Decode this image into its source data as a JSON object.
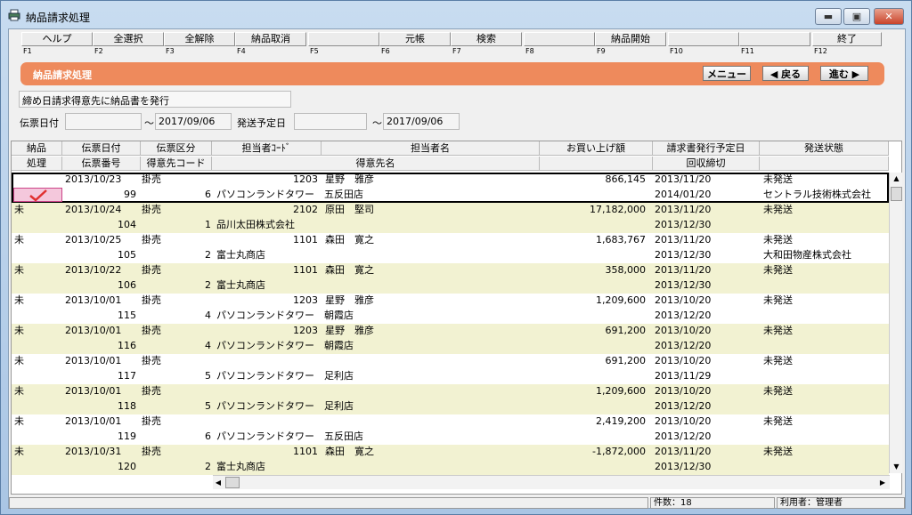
{
  "window": {
    "title": "納品請求処理"
  },
  "fkeys": [
    {
      "label": "ヘルプ",
      "key": "F1"
    },
    {
      "label": "全選択",
      "key": "F2"
    },
    {
      "label": "全解除",
      "key": "F3"
    },
    {
      "label": "納品取消",
      "key": "F4"
    },
    {
      "label": "",
      "key": "F5"
    },
    {
      "label": "元帳",
      "key": "F6"
    },
    {
      "label": "検索",
      "key": "F7"
    },
    {
      "label": "",
      "key": "F8"
    },
    {
      "label": "納品開始",
      "key": "F9"
    },
    {
      "label": "",
      "key": "F10"
    },
    {
      "label": "",
      "key": "F11"
    },
    {
      "label": "終了",
      "key": "F12"
    }
  ],
  "banner": {
    "title": "納品請求処理",
    "menu": "メニュー",
    "back": "◀ 戻る",
    "next": "進む ▶"
  },
  "description": "締め日請求得意先に納品書を発行",
  "filters": {
    "slip_date_label": "伝票日付",
    "slip_from": "",
    "tilde1": "～",
    "slip_to": "2017/09/06",
    "ship_date_label": "発送予定日",
    "ship_from": "",
    "tilde2": "～",
    "ship_to": "2017/09/06"
  },
  "headers": {
    "row1": [
      "納品",
      "伝票日付",
      "伝票区分",
      "担当者ｺｰﾄﾞ",
      "担当者名",
      "お買い上げ額",
      "請求書発行予定日",
      "発送状態"
    ],
    "row2": [
      "処理",
      "伝票番号",
      "得意先コード",
      "得意先名",
      "回収締切"
    ]
  },
  "rows": [
    {
      "status": "",
      "date": "2013/10/23",
      "kind": "掛売",
      "staff_code": "1203",
      "staff": "星野　雅彦",
      "amount": "866,145",
      "bill_date": "2013/11/20",
      "ship": "未発送",
      "no": "99",
      "cust_code": "6",
      "cust": "パソコンランドタワー　五反田店",
      "due": "2014/01/20",
      "ship2": "セントラル技術株式会社",
      "checked": true
    },
    {
      "status": "未",
      "date": "2013/10/24",
      "kind": "掛売",
      "staff_code": "2102",
      "staff": "原田　堅司",
      "amount": "17,182,000",
      "bill_date": "2013/11/20",
      "ship": "未発送",
      "no": "104",
      "cust_code": "1",
      "cust": "品川太田株式会社",
      "due": "2013/12/30",
      "ship2": ""
    },
    {
      "status": "未",
      "date": "2013/10/25",
      "kind": "掛売",
      "staff_code": "1101",
      "staff": "森田　寛之",
      "amount": "1,683,767",
      "bill_date": "2013/11/20",
      "ship": "未発送",
      "no": "105",
      "cust_code": "2",
      "cust": "富士丸商店",
      "due": "2013/12/30",
      "ship2": "大和田物産株式会社"
    },
    {
      "status": "未",
      "date": "2013/10/22",
      "kind": "掛売",
      "staff_code": "1101",
      "staff": "森田　寛之",
      "amount": "358,000",
      "bill_date": "2013/11/20",
      "ship": "未発送",
      "no": "106",
      "cust_code": "2",
      "cust": "富士丸商店",
      "due": "2013/12/30",
      "ship2": ""
    },
    {
      "status": "未",
      "date": "2013/10/01",
      "kind": "掛売",
      "staff_code": "1203",
      "staff": "星野　雅彦",
      "amount": "1,209,600",
      "bill_date": "2013/10/20",
      "ship": "未発送",
      "no": "115",
      "cust_code": "4",
      "cust": "パソコンランドタワー　朝霞店",
      "due": "2013/12/20",
      "ship2": ""
    },
    {
      "status": "未",
      "date": "2013/10/01",
      "kind": "掛売",
      "staff_code": "1203",
      "staff": "星野　雅彦",
      "amount": "691,200",
      "bill_date": "2013/10/20",
      "ship": "未発送",
      "no": "116",
      "cust_code": "4",
      "cust": "パソコンランドタワー　朝霞店",
      "due": "2013/12/20",
      "ship2": ""
    },
    {
      "status": "未",
      "date": "2013/10/01",
      "kind": "掛売",
      "staff_code": "",
      "staff": "",
      "amount": "691,200",
      "bill_date": "2013/10/20",
      "ship": "未発送",
      "no": "117",
      "cust_code": "5",
      "cust": "パソコンランドタワー　足利店",
      "due": "2013/11/29",
      "ship2": ""
    },
    {
      "status": "未",
      "date": "2013/10/01",
      "kind": "掛売",
      "staff_code": "",
      "staff": "",
      "amount": "1,209,600",
      "bill_date": "2013/10/20",
      "ship": "未発送",
      "no": "118",
      "cust_code": "5",
      "cust": "パソコンランドタワー　足利店",
      "due": "2013/12/20",
      "ship2": ""
    },
    {
      "status": "未",
      "date": "2013/10/01",
      "kind": "掛売",
      "staff_code": "",
      "staff": "",
      "amount": "2,419,200",
      "bill_date": "2013/10/20",
      "ship": "未発送",
      "no": "119",
      "cust_code": "6",
      "cust": "パソコンランドタワー　五反田店",
      "due": "2013/12/20",
      "ship2": ""
    },
    {
      "status": "未",
      "date": "2013/10/31",
      "kind": "掛売",
      "staff_code": "1101",
      "staff": "森田　寛之",
      "amount": "-1,872,000",
      "bill_date": "2013/11/20",
      "ship": "未発送",
      "no": "120",
      "cust_code": "2",
      "cust": "富士丸商店",
      "due": "2013/12/30",
      "ship2": ""
    }
  ],
  "statusbar": {
    "count": "件数：18",
    "user": "利用者：管理者"
  },
  "colors": {
    "banner": "#ee8a5c",
    "stripe": "#f2f2d2",
    "checked_bg": "#f4c8dc",
    "check": "#e03030"
  }
}
